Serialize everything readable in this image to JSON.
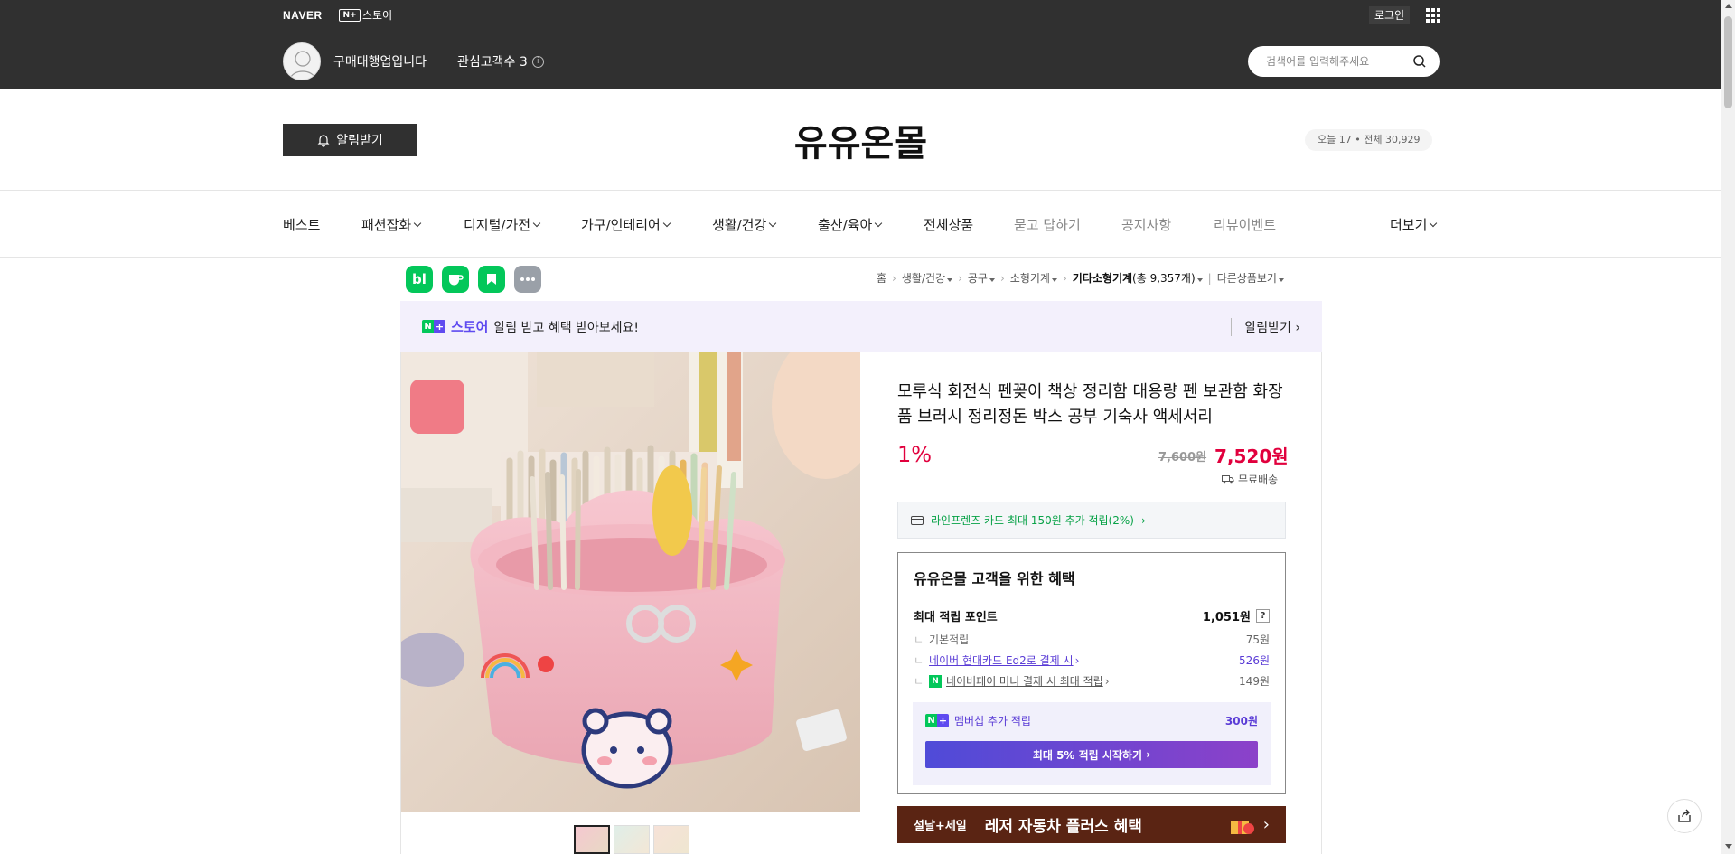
{
  "topbar": {
    "naver": "NAVER",
    "nplus_box": "N+",
    "store_label": "스토어",
    "login": "로그인",
    "owner_name": "구매대행업입니다",
    "fans_label": "관심고객수 3",
    "info_mark": "i",
    "search_placeholder": "검색어를 입력해주세요"
  },
  "header": {
    "alarm_button": "알림받기",
    "store_title": "유유온몰",
    "visitors": "오늘 17 • 전체 30,929"
  },
  "nav": {
    "items": [
      {
        "label": "베스트"
      },
      {
        "label": "패션잡화"
      },
      {
        "label": "디지털/가전"
      },
      {
        "label": "가구/인테리어"
      },
      {
        "label": "생활/건강"
      },
      {
        "label": "출산/육아"
      },
      {
        "label": "전체상품"
      },
      {
        "label": "묻고 답하기"
      },
      {
        "label": "공지사항"
      },
      {
        "label": "리뷰이벤트"
      }
    ],
    "more": "더보기"
  },
  "social": {
    "blog": "bl",
    "cafe_icon": "cafe-icon",
    "bookmark_icon": "bookmark-icon",
    "more_icon": "more-icon"
  },
  "breadcrumb": {
    "items": [
      "홈",
      "생활/건강",
      "공구",
      "소형기계",
      "기타소형기계"
    ],
    "count": "(총 9,357개)",
    "other": "다른상품보기"
  },
  "promo": {
    "n": "N",
    "plus": "+",
    "store": "스토어",
    "message": "알림 받고 혜택 받아보세요!",
    "right": "알림받기"
  },
  "product": {
    "title": "모루식 회전식 펜꽂이 책상 정리함 대용량 펜 보관함 화장품 브러시 정리정돈 박스 공부 기숙사 액세서리",
    "discount": "1%",
    "original_price": "7,600원",
    "price": "7,520원",
    "shipping": "무료배송",
    "card_benefit": "라인프렌즈 카드 최대 150원 추가 적립(2%)"
  },
  "benefits": {
    "title": "유유온몰 고객을 위한 혜택",
    "max_points_label": "최대 적립 포인트",
    "max_points_value": "1,051원",
    "help": "?",
    "rows": [
      {
        "label": "기본적립",
        "value": "75원"
      },
      {
        "label": "네이버 현대카드 Ed2로 결제 시",
        "value": "526원"
      },
      {
        "label": "네이버페이 머니 결제 시 최대 적립",
        "value": "149원"
      }
    ],
    "npay_badge": "N",
    "member_label": "멤버십 추가 적립",
    "member_value": "300원",
    "member_button": "최대 5% 적립 시작하기"
  },
  "banner": {
    "tag": "설날+세일",
    "text": "레저 자동차 플러스 혜택",
    "arrow": "›"
  },
  "colors": {
    "accent_purple": "#5f4bf0",
    "naver_green": "#03c75a",
    "sale_red": "#e1003d",
    "topbar": "#303030"
  }
}
